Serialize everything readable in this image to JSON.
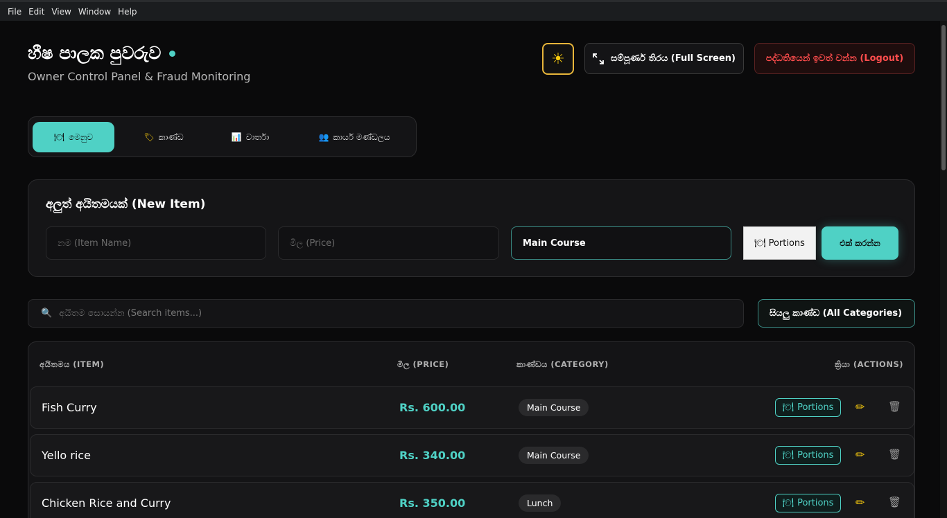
{
  "menubar": {
    "items": [
      "File",
      "Edit",
      "View",
      "Window",
      "Help"
    ]
  },
  "header": {
    "title": "හීෂ පාලක පුවරුව",
    "subtitle": "Owner Control Panel & Fraud Monitoring",
    "fullscreen_label": "සම්පූර්ණ තිරය (Full Screen)",
    "logout_label": "පද්ධතියෙන් ඉවත් වන්න (Logout)"
  },
  "tabs": [
    {
      "label": "මෙනුව",
      "icon": "menu-icon"
    },
    {
      "label": "කාණ්ඩ",
      "icon": "tag-icon"
    },
    {
      "label": "වාර්තා",
      "icon": "chart-icon"
    },
    {
      "label": "කාර්ය මණ්ඩලය",
      "icon": "staff-icon"
    }
  ],
  "new_item": {
    "title": "අලුත් අයිතමයක් (New Item)",
    "name_placeholder": "නම (Item Name)",
    "price_placeholder": "මිල (Price)",
    "category_value": "Main Course",
    "portions_label": "Portions",
    "add_label": "එක් කරන්න"
  },
  "search": {
    "placeholder": "අයිතම සොයන්න (Search items...)",
    "category_filter": "සියලු කාණ්ඩ (All Categories)"
  },
  "table": {
    "headers": {
      "item": "අයිතමය (ITEM)",
      "price": "මිල (PRICE)",
      "category": "කාණ්ඩය (CATEGORY)",
      "actions": "ක්‍රියා (ACTIONS)"
    },
    "portions_label": "Portions",
    "rows": [
      {
        "name": "Fish Curry",
        "price": "Rs. 600.00",
        "category": "Main Course"
      },
      {
        "name": "Yello rice",
        "price": "Rs. 340.00",
        "category": "Main Course"
      },
      {
        "name": "Chicken Rice and Curry",
        "price": "Rs. 350.00",
        "category": "Lunch"
      }
    ]
  },
  "colors": {
    "accent": "#4fd1c5",
    "danger": "#ff4d4d",
    "warning": "#f6c90e"
  }
}
